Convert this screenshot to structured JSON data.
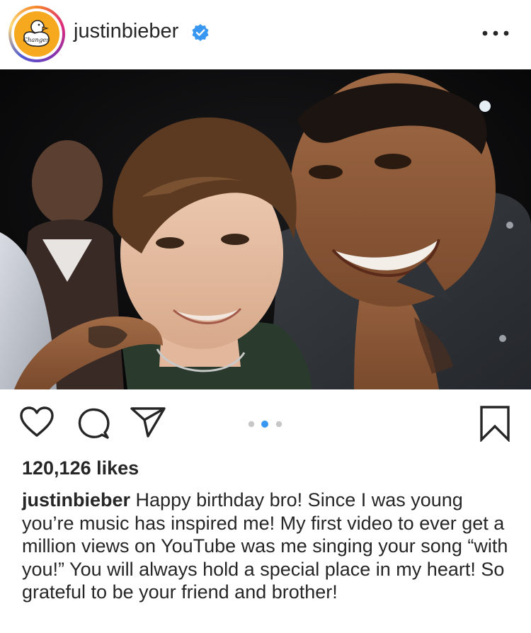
{
  "post": {
    "username": "justinbieber",
    "verified": true,
    "avatar_text": "Changes",
    "likes": "120,126 likes",
    "caption_user": "justinbieber",
    "caption_text": "Happy birthday bro! Since I was young you’re music has inspired me! My first video to ever get a million views on YouTube was me singing your song “with you!” You will always hold a special place in my heart! So grateful to be your friend and brother!",
    "carousel": {
      "count": 3,
      "active_index": 1
    }
  },
  "icons": {
    "verified": "verified-badge-icon",
    "more": "more-options-icon",
    "like": "heart-icon",
    "comment": "comment-icon",
    "share": "share-icon",
    "save": "bookmark-icon"
  },
  "colors": {
    "verified_blue": "#3897f0",
    "carousel_active": "#3897f0",
    "carousel_inactive": "#c7c7c7",
    "text": "#262626",
    "avatar_bg": "#f5a623"
  }
}
